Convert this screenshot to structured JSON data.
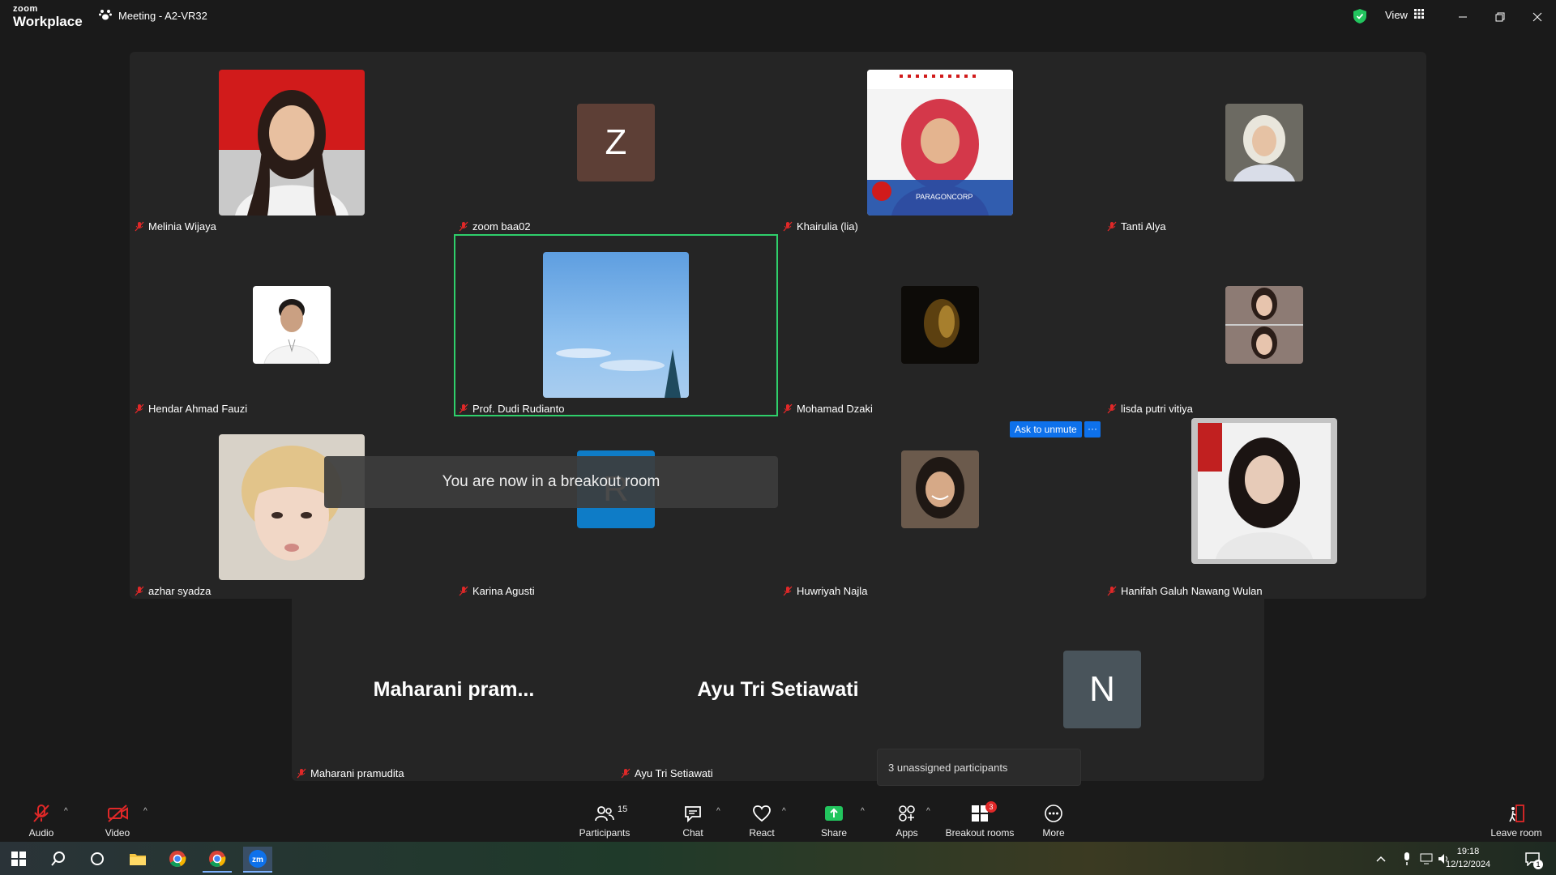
{
  "app": {
    "logo_top": "zoom",
    "logo_bottom": "Workplace",
    "meeting_title": "Meeting - A2-VR32",
    "view_label": "View"
  },
  "participants": {
    "row1": [
      "Melinia Wijaya",
      "zoom baa02",
      "Khairulia (lia)",
      "Tanti Alya"
    ],
    "row2": [
      "Hendar Ahmad Fauzi",
      "Prof. Dudi Rudianto",
      "Mohamad Dzaki",
      "lisda putri vitiya"
    ],
    "row3": [
      "azhar syadza",
      "Karina Agusti",
      "Huwriyah Najla",
      "Hanifah Galuh Nawang Wulan"
    ],
    "row4": [
      "Maharani pramudita",
      "Ayu Tri Setiawati"
    ]
  },
  "avatars": {
    "zoom_baa02_letter": "Z",
    "karina_letter": "R",
    "n_letter": "N"
  },
  "big_names": {
    "maharani": "Maharani  pram...",
    "ayu": "Ayu Tri Setiawati"
  },
  "overlays": {
    "toast": "You are now in a breakout room",
    "ask_to_unmute": "Ask to unmute",
    "more": "···",
    "unassigned": "3 unassigned participants"
  },
  "controls": {
    "audio": "Audio",
    "video": "Video",
    "participants": "Participants",
    "participants_count": "15",
    "chat": "Chat",
    "react": "React",
    "share": "Share",
    "apps": "Apps",
    "breakout": "Breakout rooms",
    "breakout_badge": "3",
    "more": "More",
    "leave": "Leave room"
  },
  "taskbar": {
    "time": "19:18",
    "date": "12/12/2024",
    "notif_count": "1"
  },
  "colors": {
    "accent_green": "#2fcf6b",
    "zoom_blue": "#0e71eb",
    "mute_red": "#e02828",
    "share_green": "#22c55e"
  }
}
